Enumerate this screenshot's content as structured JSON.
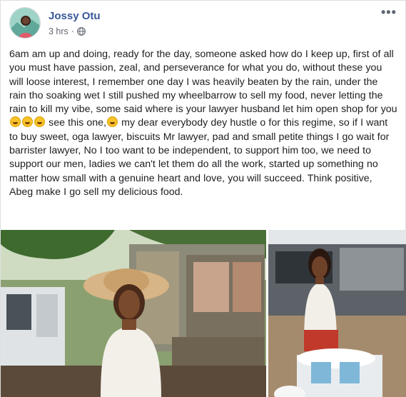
{
  "post": {
    "author": "Jossy Otu",
    "time": "3 hrs",
    "privacy_icon": "globe-icon",
    "more_icon": "more-options-icon",
    "text_part1": "6am am up and doing, ready for the day, someone asked how do I keep up, first of all you must have passion, zeal, and perseverance for what you do, without these you will loose interest, I remember one day I was heavily beaten by the rain, under the rain tho soaking wet I still pushed my wheelbarrow to sell my food, never letting the rain to kill my vibe, some said where is your lawyer husband let him open shop for you",
    "text_part2": " see this one,",
    "text_part3": " my dear everybody dey hustle o for this regime, so if I want to buy sweet, oga lawyer, biscuits Mr lawyer, pad and small petite things I go wait for barrister lawyer, No I too want to be independent, to support him too, we need to support our men, ladies we can't let them do all the work, started up something no matter how small with a genuine heart and love, you will succeed. Think positive, Abeg make I go sell my delicious food."
  },
  "colors": {
    "author_link": "#385898",
    "meta_text": "#616770",
    "body_text": "#1c1e21",
    "border": "#dddfe2"
  },
  "photos": [
    {
      "name": "photo-woman-straw-hat",
      "description_icon": "photo-1"
    },
    {
      "name": "photo-woman-with-cart",
      "description_icon": "photo-2"
    }
  ]
}
